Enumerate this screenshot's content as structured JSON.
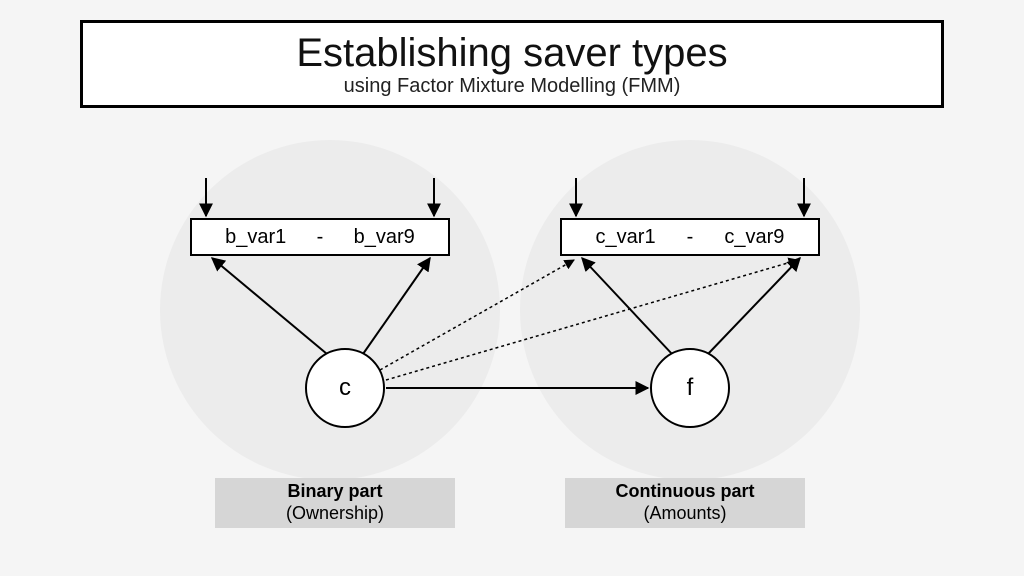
{
  "title": {
    "main": "Establishing saver types",
    "sub": "using Factor Mixture Modelling (FMM)"
  },
  "left": {
    "var_start": "b_var1",
    "var_sep": "-",
    "var_end": "b_var9",
    "node": "c",
    "label_title": "Binary part",
    "label_sub": "(Ownership)"
  },
  "right": {
    "var_start": "c_var1",
    "var_sep": "-",
    "var_end": "c_var9",
    "node": "f",
    "label_title": "Continuous part",
    "label_sub": "(Amounts)"
  }
}
